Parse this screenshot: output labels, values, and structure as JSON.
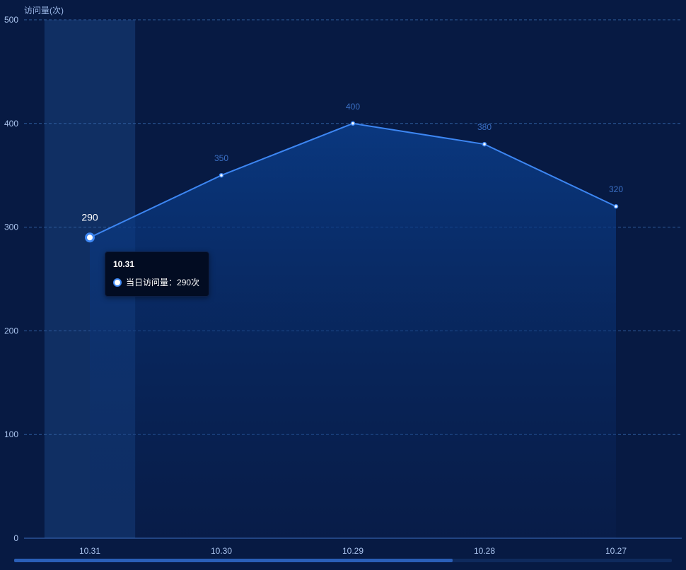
{
  "chart_data": {
    "type": "line",
    "ylabel": "访问量(次)",
    "categories": [
      "10.31",
      "10.30",
      "10.29",
      "10.28",
      "10.27"
    ],
    "series": [
      {
        "name": "当日访问量",
        "values": [
          290,
          350,
          400,
          380,
          320
        ]
      }
    ],
    "ylim": [
      0,
      500
    ],
    "yticks": [
      0,
      100,
      200,
      300,
      400,
      500
    ],
    "grid": true,
    "area_fill": true,
    "highlighted_index": 0
  },
  "tooltip": {
    "title": "10.31",
    "series_label": "当日访问量：",
    "value_text": "290次"
  },
  "colors": {
    "background": "#071a43",
    "line": "#3d86f2",
    "grid": "#2f5d9e",
    "axis_text": "#aac4ee",
    "label_text": "#3a6fc4",
    "highlight_band": "#123267"
  },
  "scrollbar": {
    "visible_fraction": 0.667
  }
}
